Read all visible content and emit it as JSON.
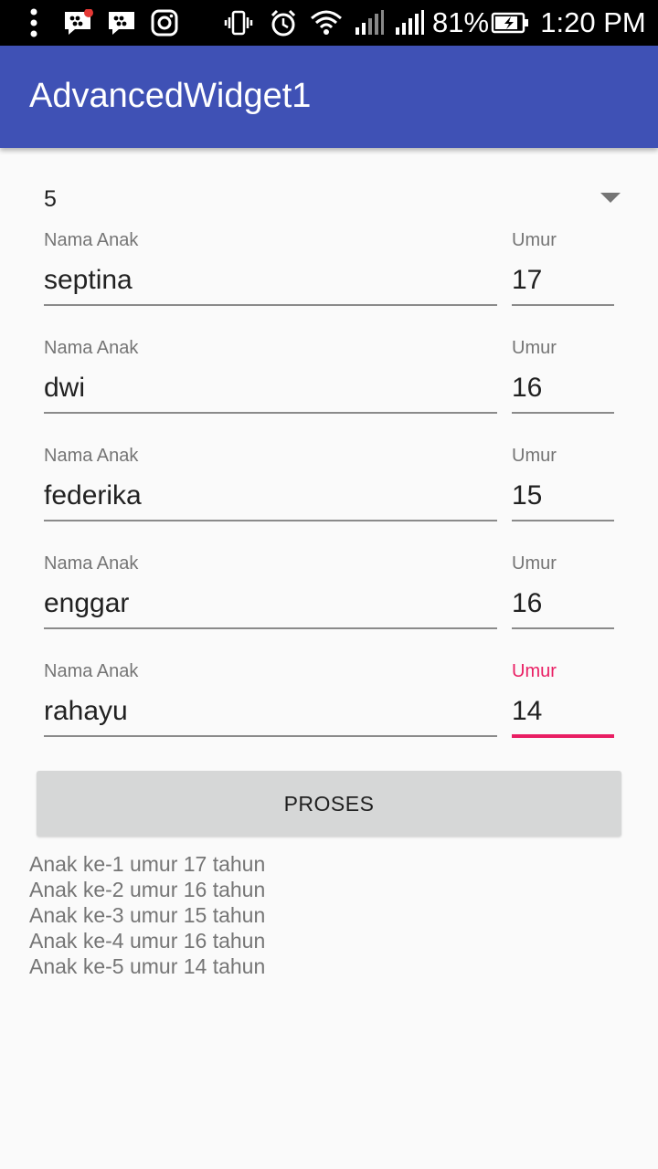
{
  "status_bar": {
    "battery_percent": "81%",
    "time": "1:20 PM",
    "icons": [
      "more-vert-icon",
      "bbm-icon",
      "bbm-icon",
      "instagram-icon",
      "vibrate-icon",
      "alarm-icon",
      "wifi-icon",
      "signal-icon",
      "signal-icon",
      "battery-icon"
    ]
  },
  "app_bar": {
    "title": "AdvancedWidget1"
  },
  "spinner": {
    "selected": "5"
  },
  "rows": [
    {
      "name_label": "Nama Anak",
      "name_value": "septina",
      "age_label": "Umur",
      "age_value": "17"
    },
    {
      "name_label": "Nama Anak",
      "name_value": "dwi",
      "age_label": "Umur",
      "age_value": "16"
    },
    {
      "name_label": "Nama Anak",
      "name_value": "federika",
      "age_label": "Umur",
      "age_value": "15"
    },
    {
      "name_label": "Nama Anak",
      "name_value": "enggar",
      "age_label": "Umur",
      "age_value": "16"
    },
    {
      "name_label": "Nama Anak",
      "name_value": "rahayu",
      "age_label": "Umur",
      "age_value": "14"
    }
  ],
  "button": {
    "label": "PROSES"
  },
  "result": {
    "lines": [
      "Anak ke-1 umur 17 tahun",
      "Anak ke-2 umur 16 tahun",
      "Anak ke-3 umur 15 tahun",
      "Anak ke-4 umur 16 tahun",
      "Anak ke-5 umur 14 tahun"
    ]
  },
  "colors": {
    "primary": "#3f51b5",
    "accent": "#e91e63",
    "background": "#fafafa"
  }
}
